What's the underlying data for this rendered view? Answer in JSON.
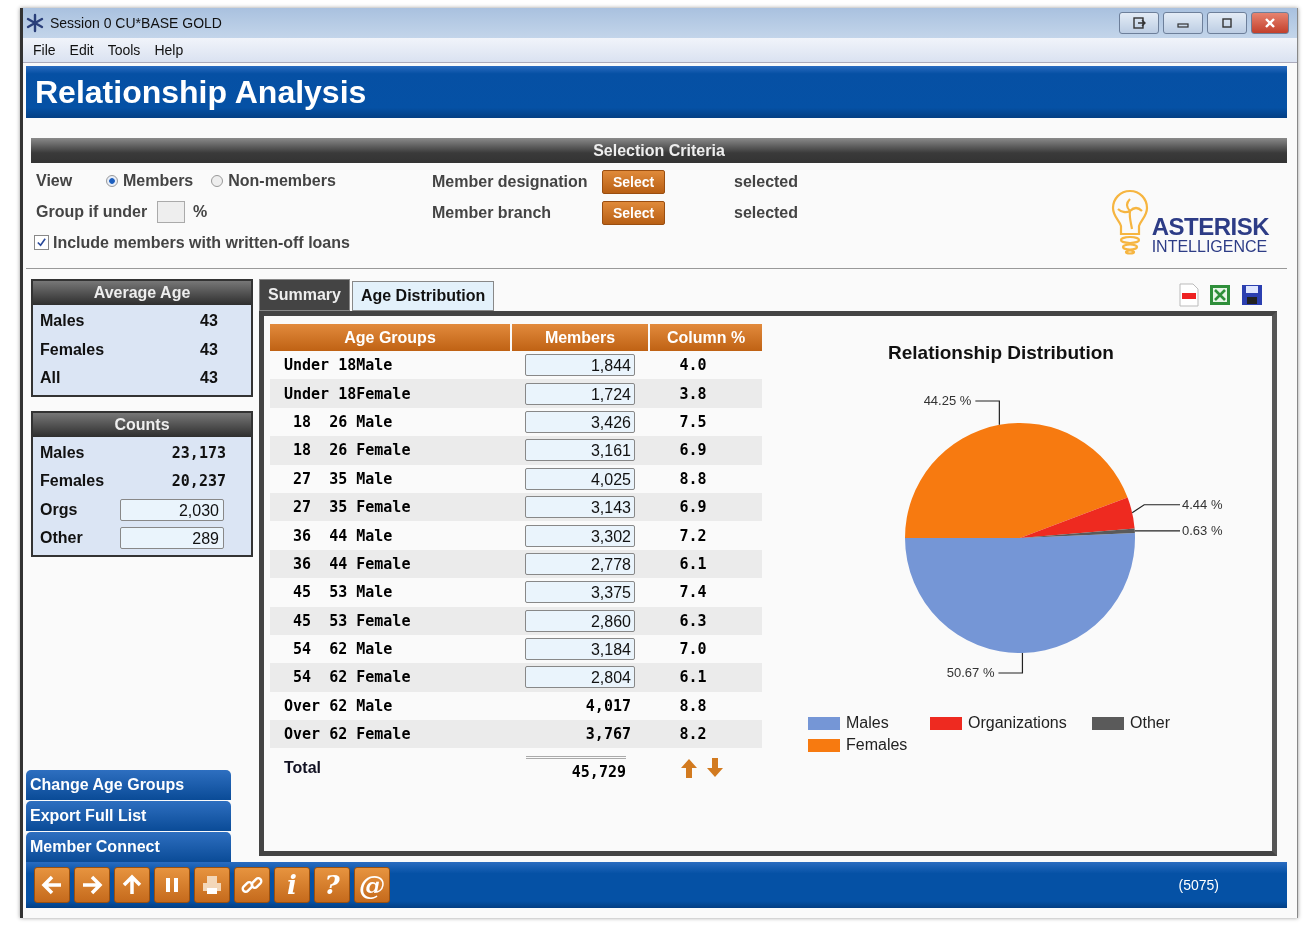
{
  "window": {
    "title": "Session 0 CU*BASE GOLD"
  },
  "menu": [
    "File",
    "Edit",
    "Tools",
    "Help"
  ],
  "page_title": "Relationship Analysis",
  "criteria": {
    "heading": "Selection Criteria",
    "view_label": "View",
    "view_options": [
      {
        "label": "Members",
        "selected": true
      },
      {
        "label": "Non-members",
        "selected": false
      }
    ],
    "group_label": "Group if under",
    "group_unit": "%",
    "include_writeoff": {
      "label": "Include members with written-off loans",
      "checked": true
    },
    "selectors": [
      {
        "label": "Member designation",
        "button": "Select",
        "status": "selected"
      },
      {
        "label": "Member branch",
        "button": "Select",
        "status": "selected"
      }
    ]
  },
  "logo": {
    "line_1": "ASTERISK",
    "line_2": "INTELLIGENCE"
  },
  "average_age": {
    "heading": "Average Age",
    "rows": [
      {
        "label": "Males",
        "value": "43"
      },
      {
        "label": "Females",
        "value": "43"
      },
      {
        "label": "All",
        "value": "43"
      }
    ]
  },
  "counts": {
    "heading": "Counts",
    "rows": [
      {
        "label": "Males",
        "value": "23,173",
        "kind": "plain"
      },
      {
        "label": "Females",
        "value": "20,237",
        "kind": "plain"
      },
      {
        "label": "Orgs",
        "value": "2,030",
        "kind": "field"
      },
      {
        "label": "Other",
        "value": "289",
        "kind": "field"
      }
    ]
  },
  "actions": [
    "Change Age Groups",
    "Export Full List",
    "Member Connect"
  ],
  "tabs": [
    {
      "label": "Summary",
      "selected": true
    },
    {
      "label": "Age Distribution",
      "selected": false
    }
  ],
  "table": {
    "columns": [
      "Age Groups",
      "Members",
      "Column %"
    ],
    "rows": [
      {
        "group": "Under 18Male",
        "members": "1,844",
        "kind": "field",
        "percent": "4.0"
      },
      {
        "group": "Under 18Female",
        "members": "1,724",
        "kind": "field",
        "percent": "3.8"
      },
      {
        "group": " 18  26 Male",
        "members": "3,426",
        "kind": "field",
        "percent": "7.5"
      },
      {
        "group": " 18  26 Female",
        "members": "3,161",
        "kind": "field",
        "percent": "6.9"
      },
      {
        "group": " 27  35 Male",
        "members": "4,025",
        "kind": "field",
        "percent": "8.8"
      },
      {
        "group": " 27  35 Female",
        "members": "3,143",
        "kind": "field",
        "percent": "6.9"
      },
      {
        "group": " 36  44 Male",
        "members": "3,302",
        "kind": "field",
        "percent": "7.2"
      },
      {
        "group": " 36  44 Female",
        "members": "2,778",
        "kind": "field",
        "percent": "6.1"
      },
      {
        "group": " 45  53 Male",
        "members": "3,375",
        "kind": "field",
        "percent": "7.4"
      },
      {
        "group": " 45  53 Female",
        "members": "2,860",
        "kind": "field",
        "percent": "6.3"
      },
      {
        "group": " 54  62 Male",
        "members": "3,184",
        "kind": "field",
        "percent": "7.0"
      },
      {
        "group": " 54  62 Female",
        "members": "2,804",
        "kind": "field",
        "percent": "6.1"
      },
      {
        "group": "Over 62 Male",
        "members": "4,017",
        "kind": "plain",
        "percent": "8.8"
      },
      {
        "group": "Over 62 Female",
        "members": "3,767",
        "kind": "plain",
        "percent": "8.2"
      }
    ],
    "total_label": "Total",
    "total": "45,729"
  },
  "chart": {
    "chart_data": {
      "type": "pie",
      "title": "Relationship Distribution",
      "categories": [
        "Males",
        "Females",
        "Organizations",
        "Other"
      ],
      "values": [
        50.67,
        44.25,
        4.44,
        0.63
      ],
      "value_labels": [
        "50.67 %",
        "44.25 %",
        "4.44 %",
        "0.63 %"
      ],
      "legend": true
    },
    "slices": [
      {
        "color": "#7596d6"
      },
      {
        "color": "#f77a10"
      },
      {
        "color": "#ee2a20"
      },
      {
        "color": "#5a5a5a"
      }
    ]
  },
  "toolbar": [
    {
      "kind": "back"
    },
    {
      "kind": "forward"
    },
    {
      "kind": "up"
    },
    {
      "kind": "pause"
    },
    {
      "kind": "print"
    },
    {
      "kind": "link"
    },
    {
      "kind": "glyph",
      "label": "i"
    },
    {
      "kind": "glyph",
      "label": "?"
    },
    {
      "kind": "glyph",
      "label": "@"
    }
  ],
  "status_code": "(5075)"
}
